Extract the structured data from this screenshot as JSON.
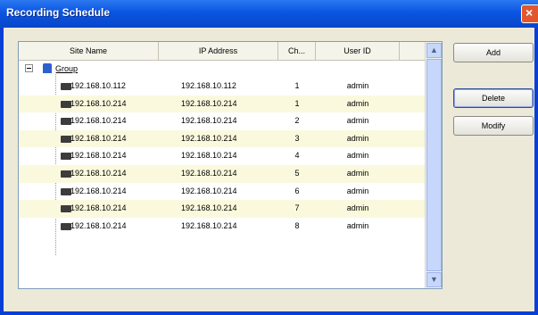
{
  "window": {
    "title": "Recording Schedule",
    "close_glyph": "×"
  },
  "table": {
    "columns": [
      "Site Name",
      "IP Address",
      "Ch...",
      "User ID"
    ],
    "group": {
      "label": "Group",
      "icon": "group-icon"
    },
    "rows": [
      {
        "site": "192.168.10.112",
        "ip": "192.168.10.112",
        "ch": "1",
        "user": "admin"
      },
      {
        "site": "192.168.10.214",
        "ip": "192.168.10.214",
        "ch": "1",
        "user": "admin"
      },
      {
        "site": "192.168.10.214",
        "ip": "192.168.10.214",
        "ch": "2",
        "user": "admin"
      },
      {
        "site": "192.168.10.214",
        "ip": "192.168.10.214",
        "ch": "3",
        "user": "admin"
      },
      {
        "site": "192.168.10.214",
        "ip": "192.168.10.214",
        "ch": "4",
        "user": "admin"
      },
      {
        "site": "192.168.10.214",
        "ip": "192.168.10.214",
        "ch": "5",
        "user": "admin"
      },
      {
        "site": "192.168.10.214",
        "ip": "192.168.10.214",
        "ch": "6",
        "user": "admin"
      },
      {
        "site": "192.168.10.214",
        "ip": "192.168.10.214",
        "ch": "7",
        "user": "admin"
      },
      {
        "site": "192.168.10.214",
        "ip": "192.168.10.214",
        "ch": "8",
        "user": "admin"
      }
    ]
  },
  "buttons": {
    "add": "Add",
    "delete": "Delete",
    "modify": "Modify"
  },
  "scrollbar": {
    "up_glyph": "▲",
    "down_glyph": "▼"
  },
  "colors": {
    "title_bar": "#0a55e2",
    "row_alt": "#fbf9dd",
    "window_bg": "#ece9d8"
  }
}
